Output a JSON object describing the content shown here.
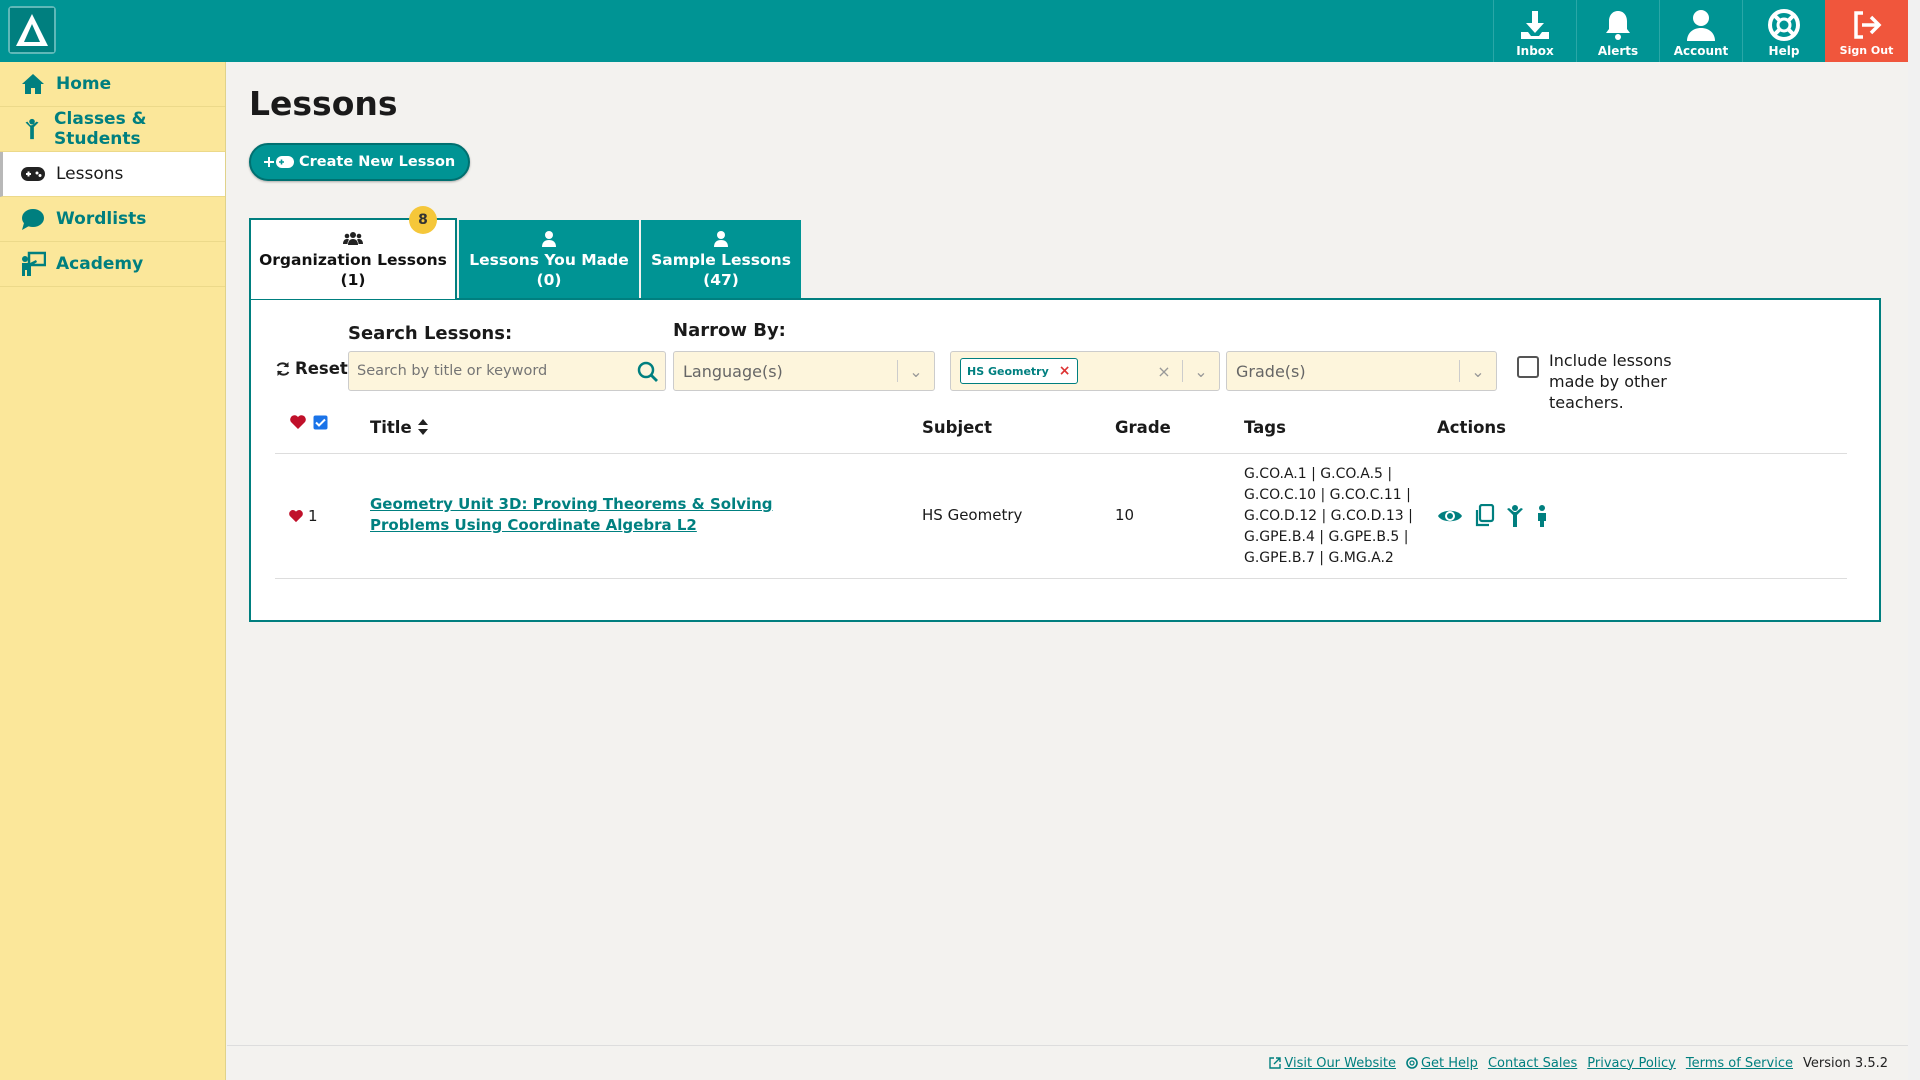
{
  "topnav": {
    "inbox": "Inbox",
    "alerts": "Alerts",
    "account": "Account",
    "help": "Help",
    "signout": "Sign Out"
  },
  "sidebar": {
    "items": [
      {
        "label": "Home",
        "icon": "home-icon"
      },
      {
        "label": "Classes & Students",
        "icon": "student-icon"
      },
      {
        "label": "Lessons",
        "icon": "gamepad-icon"
      },
      {
        "label": "Wordlists",
        "icon": "speech-bubble-icon"
      },
      {
        "label": "Academy",
        "icon": "teacher-board-icon"
      }
    ],
    "active": "Lessons"
  },
  "page": {
    "title": "Lessons",
    "create_label": "Create New Lesson"
  },
  "tabs": [
    {
      "label": "Organization Lessons",
      "count": "(1)",
      "badge": "8"
    },
    {
      "label": "Lessons You Made",
      "count": "(0)"
    },
    {
      "label": "Sample Lessons",
      "count": "(47)"
    }
  ],
  "filters": {
    "reset": "Reset",
    "search_label": "Search Lessons:",
    "search_placeholder": "Search by title or keyword",
    "narrow_label": "Narrow By:",
    "language_placeholder": "Language(s)",
    "subject_chip": "HS Geometry",
    "grade_placeholder": "Grade(s)",
    "include_label": "Include lessons made by other teachers."
  },
  "table": {
    "headers": {
      "title": "Title",
      "subject": "Subject",
      "grade": "Grade",
      "tags": "Tags",
      "actions": "Actions"
    },
    "rows": [
      {
        "likes": "1",
        "title": "Geometry Unit 3D: Proving Theorems & Solving Problems Using Coordinate Algebra L2",
        "subject": "HS Geometry",
        "grade": "10",
        "tags": [
          "G.CO.A.1 | G.CO.A.5 |",
          "G.CO.C.10 | G.CO.C.11 |",
          "G.CO.D.12 | G.CO.D.13 |",
          "G.GPE.B.4 | G.GPE.B.5 |",
          "G.GPE.B.7 | G.MG.A.2"
        ]
      }
    ]
  },
  "footer": {
    "visit": "Visit Our Website",
    "help": "Get Help",
    "sales": "Contact Sales",
    "privacy": "Privacy Policy",
    "terms": "Terms of Service",
    "version": "Version 3.5.2"
  },
  "colors": {
    "teal": "#009494",
    "sidebar": "#fbe79a",
    "signout": "#f0563c",
    "badge": "#f5c73a"
  }
}
